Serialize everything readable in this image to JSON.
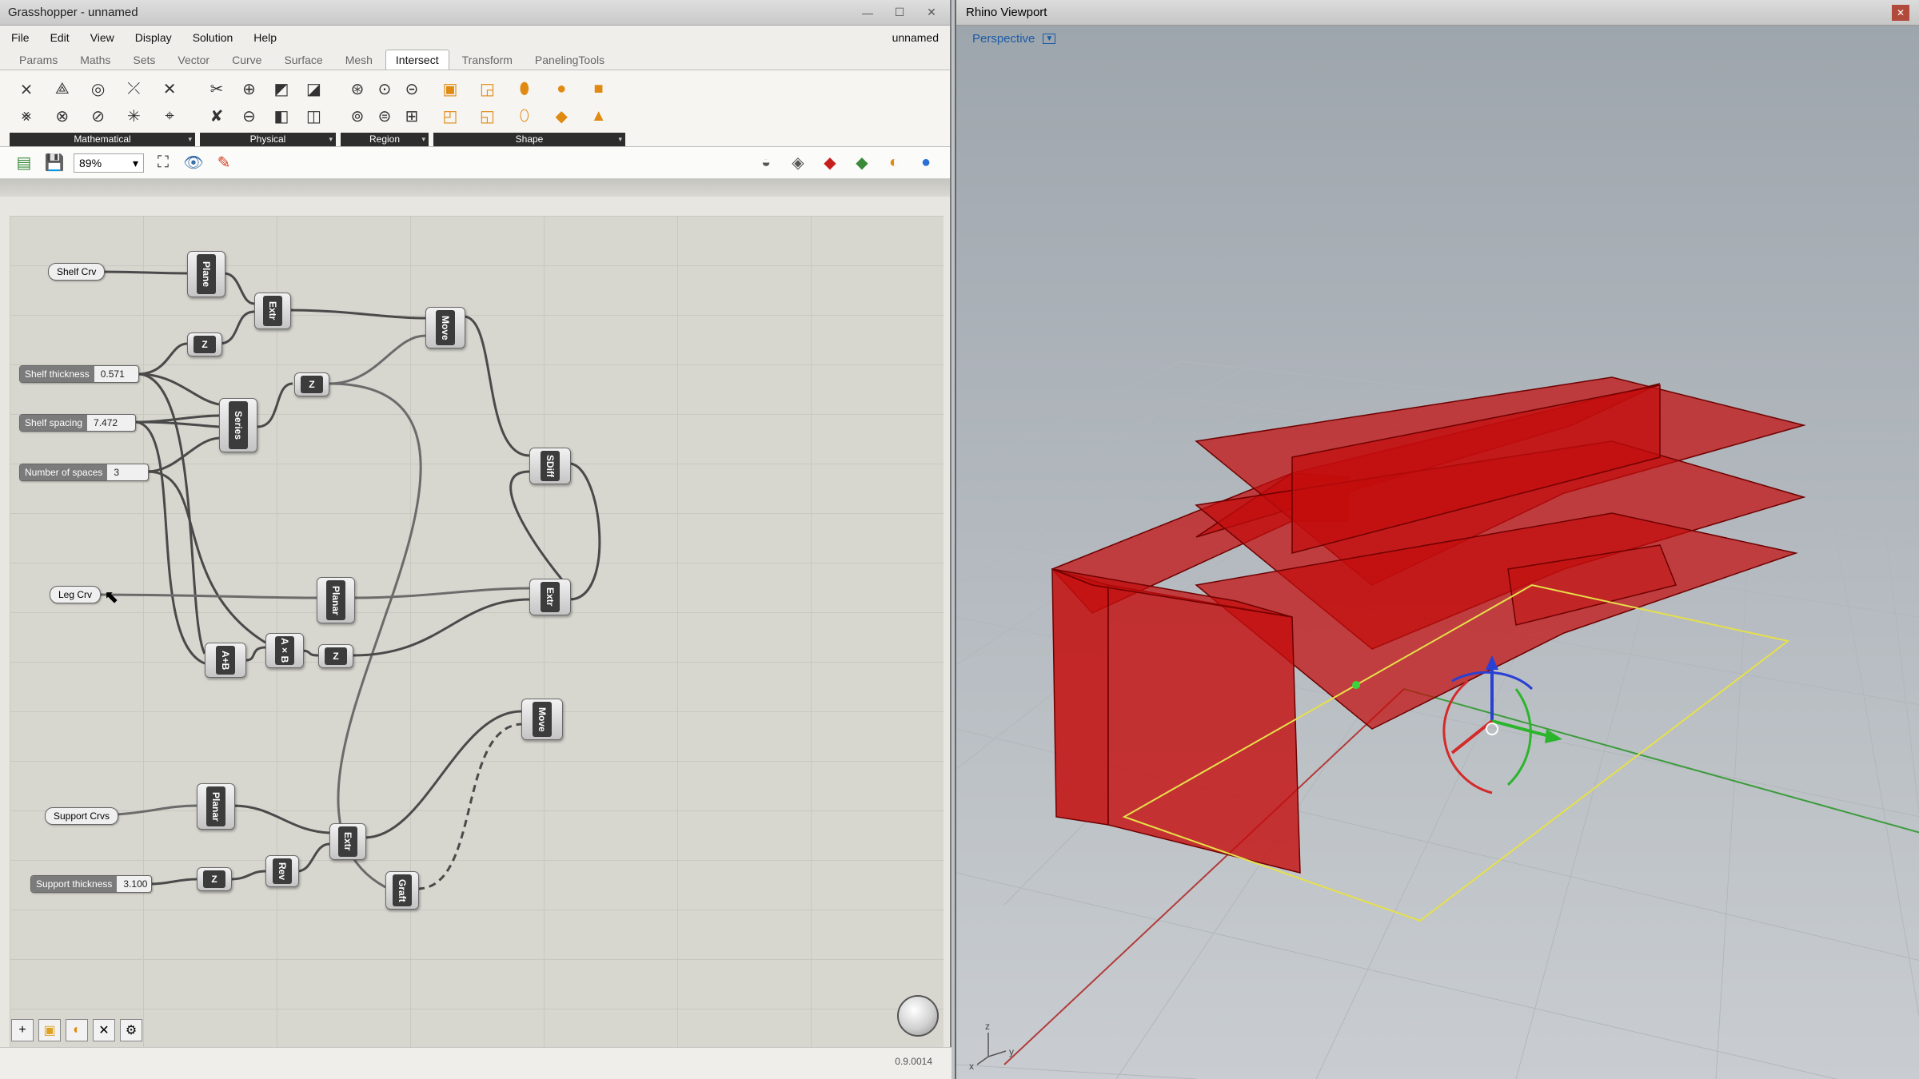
{
  "grasshopper": {
    "title": "Grasshopper - unnamed",
    "menu": [
      "File",
      "Edit",
      "View",
      "Display",
      "Solution",
      "Help"
    ],
    "doc_name": "unnamed",
    "tabs": [
      "Params",
      "Maths",
      "Sets",
      "Vector",
      "Curve",
      "Surface",
      "Mesh",
      "Intersect",
      "Transform",
      "PanelingTools"
    ],
    "active_tab": "Intersect",
    "ribbon_groups": [
      "Mathematical",
      "Physical",
      "Region",
      "Shape"
    ],
    "zoom": "89%",
    "sliders": [
      {
        "name": "Shelf thickness",
        "value": "0.571"
      },
      {
        "name": "Shelf spacing",
        "value": "7.472"
      },
      {
        "name": "Number of spaces",
        "value": "3"
      },
      {
        "name": "Support thickness",
        "value": "3.100"
      }
    ],
    "params": [
      "Shelf Crv",
      "Leg Crv",
      "Support Crvs"
    ],
    "components": [
      "Plane",
      "Extr",
      "Z",
      "Move",
      "Z",
      "Series",
      "SDiff",
      "Planar",
      "Extr",
      "A+B",
      "A×B",
      "Z",
      "Move",
      "Planar",
      "Extr",
      "Z",
      "Rev",
      "Graft"
    ],
    "version": "0.9.0014"
  },
  "rhino": {
    "title": "Rhino Viewport",
    "view_name": "Perspective",
    "axis_labels": {
      "x": "x",
      "y": "y",
      "z": "z"
    }
  },
  "colors": {
    "shelf_red": "#c40d0d",
    "selection_yellow": "#e6e04a",
    "gh_canvas": "#d7d6cf"
  }
}
